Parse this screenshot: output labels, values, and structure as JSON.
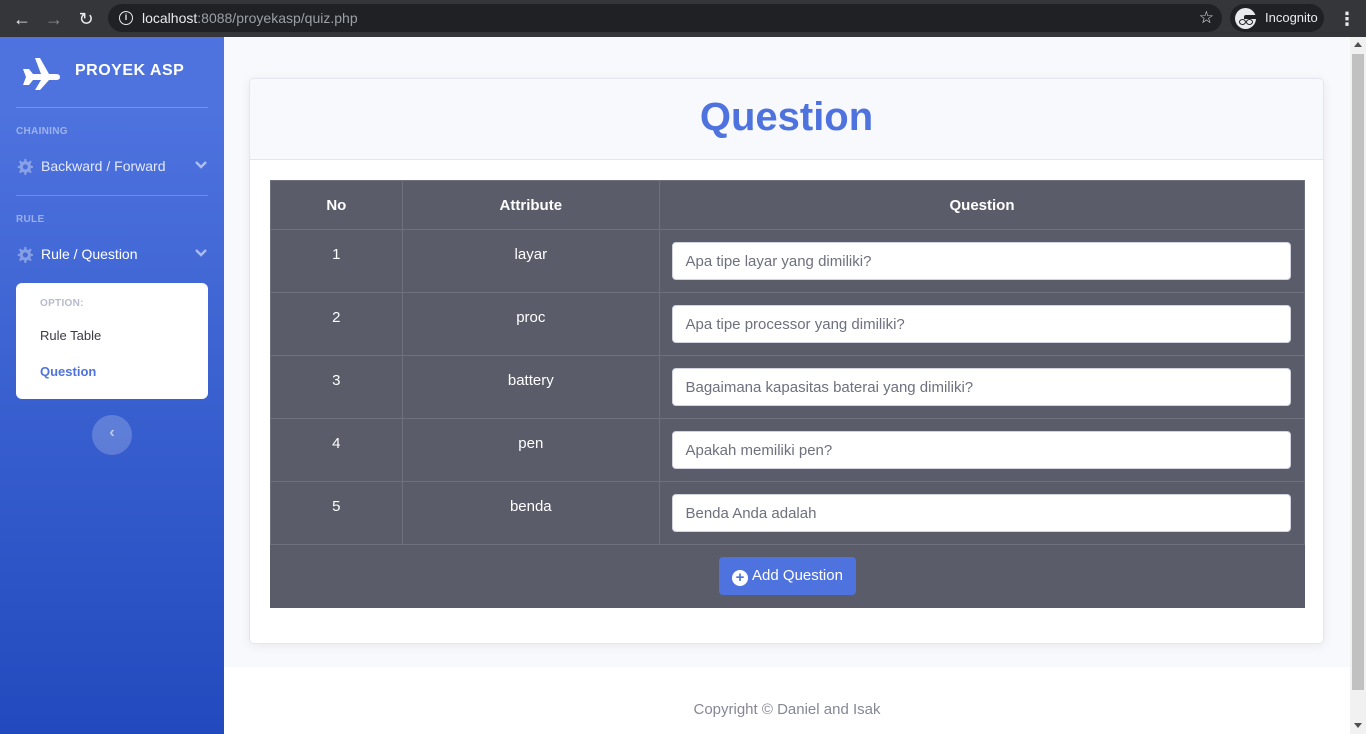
{
  "browser": {
    "url_host": "localhost",
    "url_rest": ":8088/proyekasp/quiz.php",
    "profile_label": "Incognito",
    "back_icon": "arrow-left-icon",
    "forward_icon": "arrow-right-icon",
    "reload_icon": "reload-icon",
    "star_icon": "star-icon"
  },
  "sidebar": {
    "brand": "PROYEK ASP",
    "brand_icon": "plane-icon",
    "heading_chaining": "CHAINING",
    "item_chaining": "Backward / Forward",
    "heading_rule": "RULE",
    "item_rule": "Rule / Question",
    "collapse": {
      "header": "OPTION:",
      "items": [
        {
          "label": "Rule Table",
          "active": false
        },
        {
          "label": "Question",
          "active": true
        }
      ]
    },
    "toggle_icon": "chevron-left-icon"
  },
  "main": {
    "title": "Question",
    "table": {
      "headers": [
        "No",
        "Attribute",
        "Question"
      ],
      "rows": [
        {
          "no": "1",
          "attribute": "layar",
          "placeholder": "Apa tipe layar yang dimiliki?"
        },
        {
          "no": "2",
          "attribute": "proc",
          "placeholder": "Apa tipe processor yang dimiliki?"
        },
        {
          "no": "3",
          "attribute": "battery",
          "placeholder": "Bagaimana kapasitas baterai yang dimiliki?"
        },
        {
          "no": "4",
          "attribute": "pen",
          "placeholder": "Apakah memiliki pen?"
        },
        {
          "no": "5",
          "attribute": "benda",
          "placeholder": "Benda Anda adalah"
        }
      ]
    },
    "add_button": "Add Question"
  },
  "footer": {
    "text": "Copyright © Daniel and Isak"
  },
  "colors": {
    "primary": "#4e73df",
    "table_bg": "#5a5c69",
    "sidebar_end": "#224abe"
  }
}
